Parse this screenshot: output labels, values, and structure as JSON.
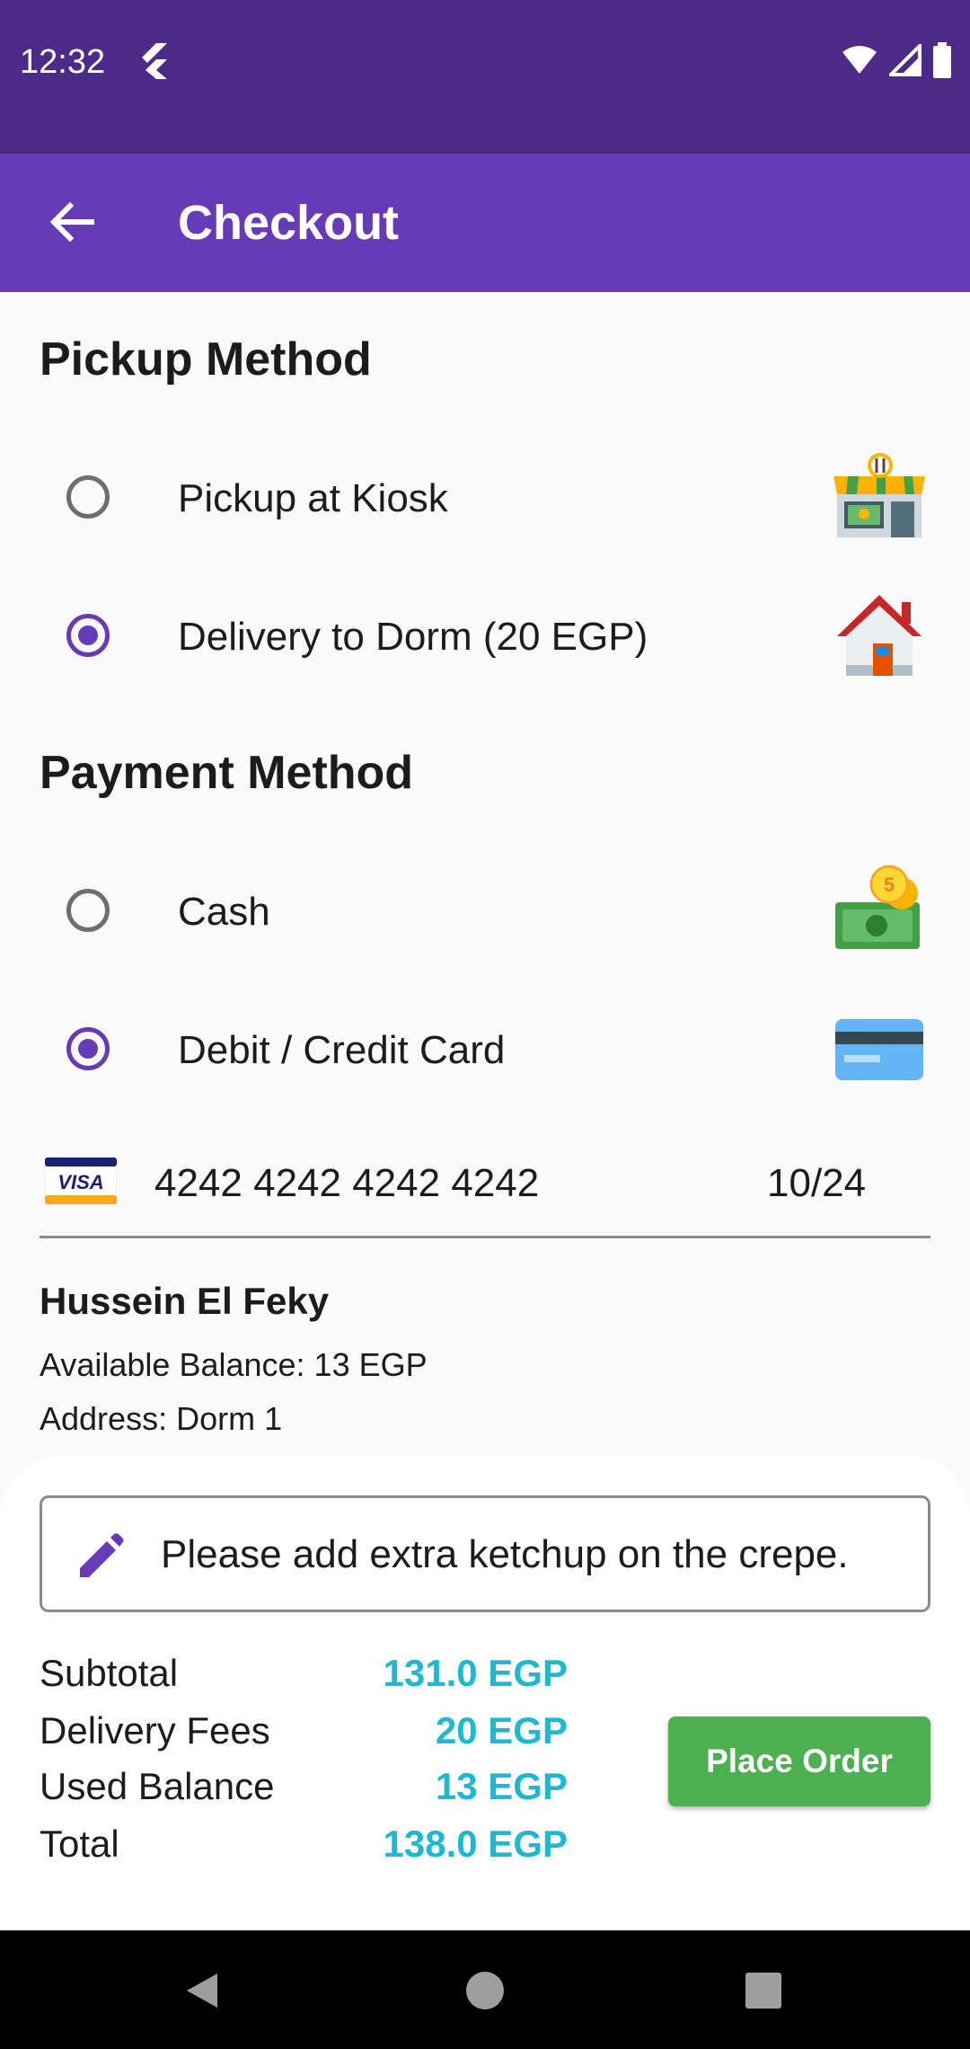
{
  "status_bar": {
    "time": "12:32",
    "app_icon": "flutter-icon",
    "icons": [
      "wifi-icon",
      "signal-icon",
      "battery-icon"
    ]
  },
  "app_bar": {
    "back_icon": "arrow-back-icon",
    "title": "Checkout",
    "color": "#673ab7"
  },
  "pickup": {
    "title": "Pickup Method",
    "options": [
      {
        "label": "Pickup at Kiosk",
        "selected": false,
        "icon": "kiosk-store-icon"
      },
      {
        "label": "Delivery to Dorm (20 EGP)",
        "selected": true,
        "icon": "house-icon"
      }
    ]
  },
  "payment": {
    "title": "Payment Method",
    "options": [
      {
        "label": "Cash",
        "selected": false,
        "icon": "cash-money-icon"
      },
      {
        "label": "Debit / Credit Card",
        "selected": true,
        "icon": "credit-card-icon"
      }
    ],
    "card": {
      "brand": "VISA",
      "number": "4242 4242 4242 4242",
      "expiry": "10/24"
    }
  },
  "user": {
    "name": "Hussein El Feky",
    "balance": "Available Balance: 13 EGP",
    "address": "Address: Dorm 1"
  },
  "note": {
    "icon": "edit-pencil-icon",
    "text": "Please add extra ketchup on the crepe."
  },
  "summary": {
    "rows": [
      {
        "label": "Subtotal",
        "value": "131.0 EGP"
      },
      {
        "label": "Delivery Fees",
        "value": "20 EGP"
      },
      {
        "label": "Used Balance",
        "value": "13 EGP"
      },
      {
        "label": "Total",
        "value": "138.0 EGP"
      }
    ],
    "value_color": "#1eb8d0"
  },
  "place_order": {
    "label": "Place Order",
    "color": "#4caf50"
  },
  "nav": [
    "back-triangle-icon",
    "home-circle-icon",
    "recents-square-icon"
  ]
}
